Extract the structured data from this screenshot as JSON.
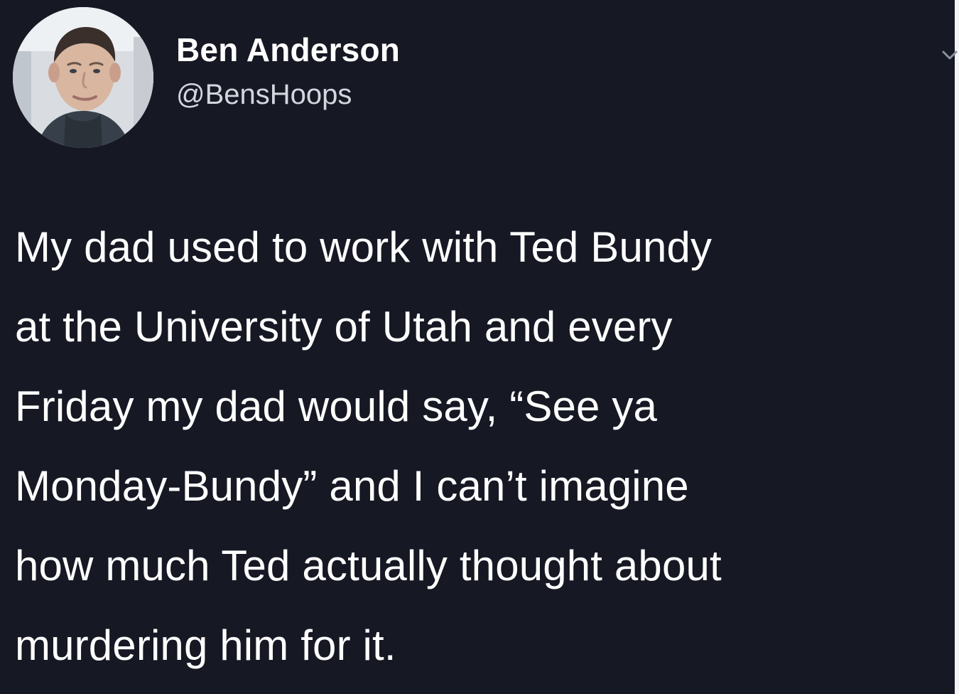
{
  "tweet": {
    "author": {
      "display_name": "Ben Anderson",
      "handle": "@BensHoops",
      "avatar_icon": "profile-photo"
    },
    "menu_icon": "chevron-down-icon",
    "body_lines": [
      "My dad used to work with Ted Bundy",
      "at the University of Utah and every",
      "Friday my dad would say, “See ya",
      "Monday-Bundy” and I can’t imagine",
      "how much Ted actually thought about",
      "murdering him for it."
    ]
  },
  "colors": {
    "background": "#161823",
    "text": "#ffffff",
    "secondary_text": "#d4d6df",
    "right_edge": "#f4f4f6"
  }
}
